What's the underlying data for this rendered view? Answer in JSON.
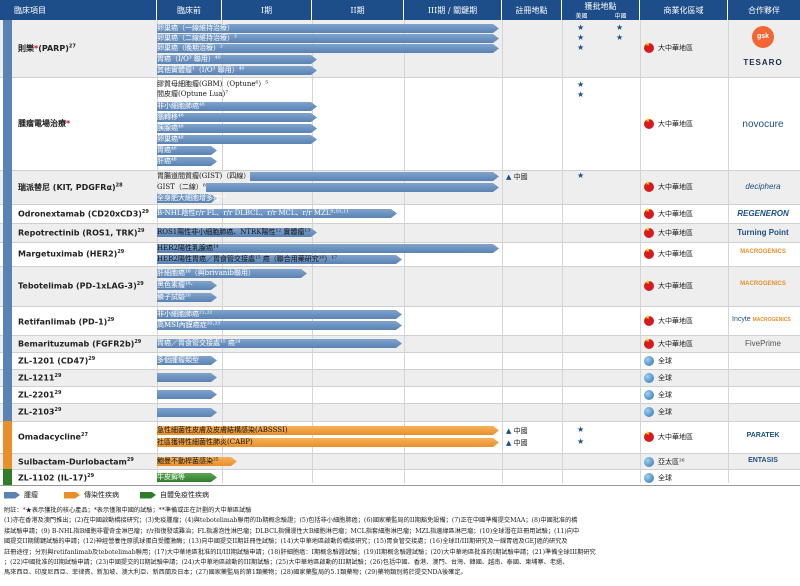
{
  "header": {
    "col_item": "臨床項目",
    "col_preclinical": "臨床前",
    "col_phase1": "I期",
    "col_phase2": "II期",
    "col_phase3": "III期 / 關鍵期",
    "col_registration": "註冊地點",
    "col_approval": "獲批地點",
    "col_approval_us": "美國",
    "col_approval_cn": "中國",
    "col_region": "商業化區域",
    "col_partner": "合作夥伴"
  },
  "rows": {
    "zejula": {
      "name": "則樂",
      "sup": "(PARP)",
      "fn": "27",
      "indications": [
        "卵巢癌（一線維持治療）",
        "卵巢癌（二線維持治療）³",
        "卵巢癌（晚期治療）²",
        "胃癌（I/O³ 聯用）⁴⁹",
        "其他實體瘤¹（I/O³ 聯用）⁴⁹"
      ],
      "region": "大中華地區",
      "partner1": "gsk",
      "partner2": "TESARO"
    },
    "ttf": {
      "name": "腫瘤電場治療",
      "indications": [
        "膠質母細胞瘤(GBM)（Optune⁶）⁵",
        "間皮瘤(Optune Lua)⁷",
        "非小細胞肺癌⁴⁸",
        "腦轉移⁴⁸",
        "胰腺癌⁴⁸",
        "卵巢癌⁴⁸",
        "胃癌⁴⁸",
        "肝癌⁴⁸"
      ],
      "region": "大中華地區",
      "partner": "novocure"
    },
    "ripretinib": {
      "name": "瑞派替尼 (KIT, PDGFRα)",
      "fn": "28",
      "indications": [
        "胃腸道間質瘤(GIST)（四線）",
        "GIST（二線）⁸",
        "全身肥大細胞增多症⁴⁸"
      ],
      "registration": "中國",
      "region": "大中華地區",
      "partner": "deciphera"
    },
    "odronextamab": {
      "name": "Odronextamab (CD20xCD3)",
      "fn": "29",
      "indications": [
        "B-NHL陰性r/r FL、r/r DLBCL、r/r MCL、r/r MZL⁹·¹⁰·¹¹"
      ],
      "region": "大中華地區",
      "partner": "REGENERON"
    },
    "repotrectinib": {
      "name": "Repotrectinib (ROS1, TRK)",
      "fn": "29",
      "indications": [
        "ROS1陽性非小細胞肺癌、NTRK陽性¹² 實體瘤¹³"
      ],
      "region": "大中華地區",
      "partner": "Turning Point"
    },
    "margetuximab": {
      "name": "Margetuximab (HER2)",
      "fn": "29",
      "indications": [
        "HER2陽性乳腺癌¹⁴",
        "HER2陽性胃癌／胃食管交接處¹⁵ 癌（聯合用藥研究¹⁶）¹⁷"
      ],
      "region": "大中華地區",
      "partner": "MACROGENICS"
    },
    "tebotelimab": {
      "name": "Tebotelimab (PD-1xLAG-3)",
      "fn": "29",
      "indications": [
        "肝細胞癌¹⁸（與brivanib聯用）",
        "黑色素瘤¹⁸·",
        "鱗子試驗²⁰"
      ],
      "region": "大中華地區",
      "partner": "MACROGENICS"
    },
    "retifanlimab": {
      "name": "Retifanlimab (PD-1)",
      "fn": "29",
      "indications": [
        "非小細胞肺癌²¹·²²",
        "高MSI內膜癌症²⁰·²³"
      ],
      "region": "大中華地區",
      "partner1": "Incyte",
      "partner2": "MACROGENICS"
    },
    "bemarituzumab": {
      "name": "Bemarituzumab (FGFR2b)",
      "fn": "29",
      "indications": [
        "胃癌／胃食管交接處¹⁵ 癌²⁴"
      ],
      "region": "大中華地區",
      "partner": "FivePrime"
    },
    "zl1201": {
      "name": "ZL-1201 (CD47)",
      "fn": "29",
      "indications": [
        "多個腫瘤類型"
      ],
      "region": "全球"
    },
    "zl1211": {
      "name": "ZL-1211",
      "fn": "29",
      "region": "全球"
    },
    "zl2201": {
      "name": "ZL-2201",
      "fn": "29",
      "region": "全球"
    },
    "zl2103": {
      "name": "ZL-2103",
      "fn": "29",
      "region": "全球"
    },
    "omadacycline": {
      "name": "Omadacycline",
      "fn": "27",
      "indications": [
        "急性細菌性皮膚及皮膚結構感染(ABSSSI)",
        "社區獲得性細菌性肺炎(CABP)"
      ],
      "registration1": "中國",
      "registration2": "中國",
      "region": "大中華地區",
      "partner": "PARATEK"
    },
    "sulbactam": {
      "name": "Sulbactam-Durlobactam",
      "fn": "29",
      "indications": [
        "鮑曼不動桿菌感染²⁵"
      ],
      "region": "亞太區²⁶",
      "partner": "ENTASIS"
    },
    "zl1102": {
      "name": "ZL-1102 (IL-17)",
      "fn": "29",
      "indications": [
        "牛皮癬等"
      ],
      "region": "全球"
    }
  },
  "legend": {
    "oncology": "腫瘤",
    "infectious": "傳染性疾病",
    "autoimmune": "自體免疫性疾病"
  },
  "colors": {
    "oncology": "#5a82b3",
    "infectious": "#e98f2a",
    "autoimmune": "#2f7d2b",
    "header": "#1d4e89"
  },
  "notes": {
    "title": "附註：",
    "text": "★表示獲批的核心產品；*表示僅限中國的試驗；**準備或正在計劃的大中華區試驗",
    "line1": "(1)亦在香港及澳門推出；(2)在中國啟動橋接研究；(3)免疫腫瘤；(4)與tebotelimab聯用的Ib期概念驗證；(5)包括非小細胞肺癌；(6)國家藥監局的II期豁免設備；(7)正在中國準備提交MAA；(8)中國批准的橋",
    "line2": "接試驗申請；(9) B-NHL指B細胞非霍奇金淋巴瘤；r/r指復發或難治；FL指濾泡性淋巴瘤；DLBCL指彌漫性大B細胞淋巴瘤；MCL指套細胞淋巴瘤；MZL指邊緣區淋巴瘤；(10)全球潛在註冊用試驗；(11)向中",
    "line3": "國提交II期關鍵試驗的申請；(12)神經營養性原肌球蛋白受體激酶；(13)向中國提交II期註冊性試驗；(14)大中華地區啟動的橋接研究；(15)胃食管交接處；(16)全球II/III期研究及一線胃癌及GEJ癌的研究及",
    "line4": "註冊途徑；分別與retifanlimab及tebotelimab聯用；(17)大中華地區批准的II/III期試驗申請；(18)肝細胞癌：I期概念驗證試驗；(19)II期概念驗證試驗；(20)大中華地區批准的I期試驗申請；(21)準備全球III期研究",
    "line5": "；(22)中國批准的II期試驗申請；(23)中國提交的II期試驗申請；(24)大中華地區啟動的III期試驗；(25)大中華地區啟動的III期試驗；(26)包括中國、香港、澳門、台灣、韓國、越南、泰國、柬埔寨、老撾、",
    "line6": "馬來西亞、印度尼西亞、菲律賓、新加坡、澳大利亞、新西蘭及日本；(27)國家藥監局的第1類藥物；(28)國家藥監局的5.1類藥物；(29)藥物類別將於提交NDA後確定。"
  }
}
